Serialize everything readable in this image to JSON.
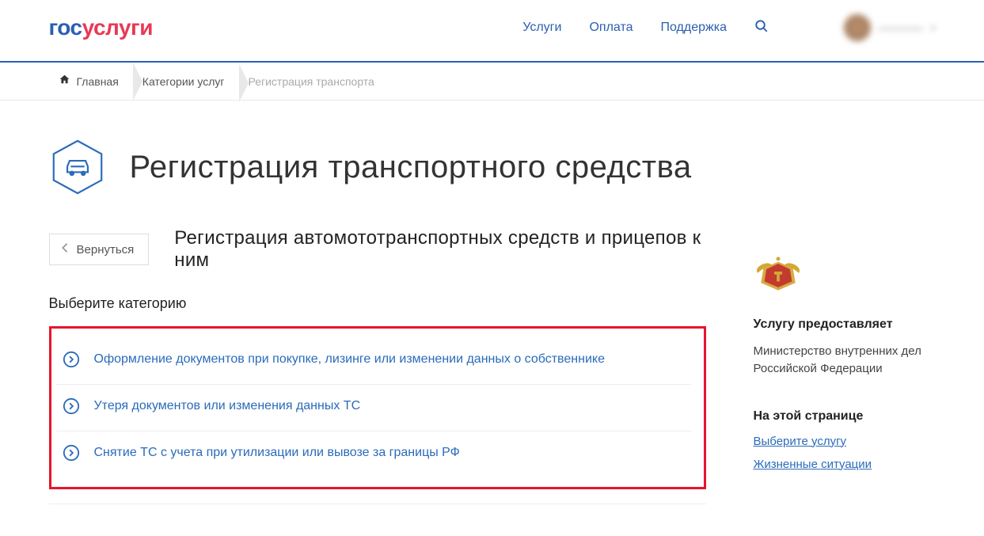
{
  "header": {
    "logo_part1": "гос",
    "logo_part2": "услуги",
    "nav": {
      "services": "Услуги",
      "payment": "Оплата",
      "support": "Поддержка"
    },
    "user_name": "————"
  },
  "breadcrumb": {
    "home": "Главная",
    "categories": "Категории услуг",
    "current": "Регистрация транспорта"
  },
  "page": {
    "title": "Регистрация транспортного средства",
    "back_label": "Вернуться",
    "subtitle": "Регистрация автомототранспортных средств и прицепов к ним",
    "select_label": "Выберите категорию",
    "categories": [
      "Оформление документов при покупке, лизинге или изменении данных о собственнике",
      "Утеря документов или изменения данных ТС",
      "Снятие ТС с учета при утилизации или вывозе за границы РФ"
    ]
  },
  "sidebar": {
    "provider_head": "Услугу предоставляет",
    "provider_text": "Министерство внутренних дел Российской Федерации",
    "on_page_head": "На этой странице",
    "link1": "Выберите услугу",
    "link2": "Жизненные ситуации"
  }
}
